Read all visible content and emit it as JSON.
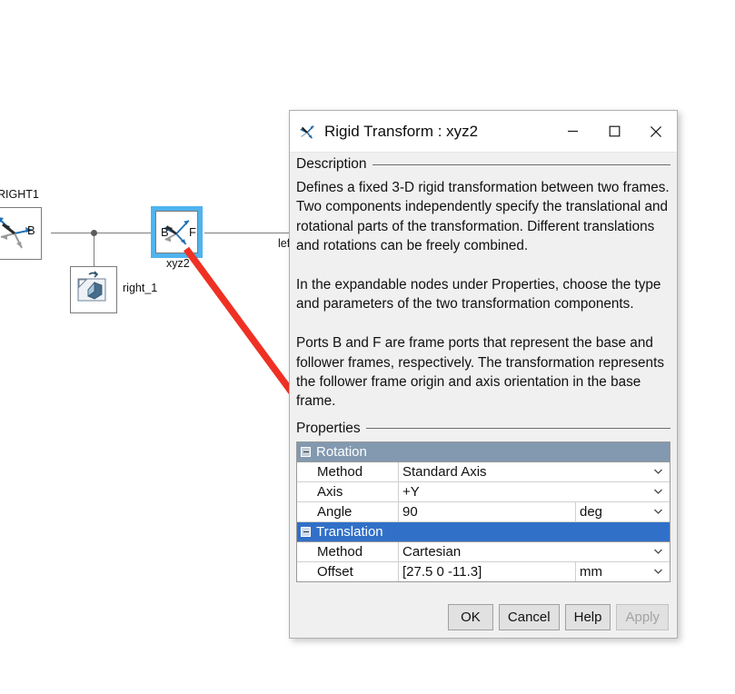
{
  "canvas": {
    "blocks": [
      {
        "name": "RIGHT1",
        "port_b": "B",
        "label_position": "top"
      },
      {
        "name": "right_1",
        "label_position": "right"
      },
      {
        "name": "xyz2",
        "port_b": "B",
        "port_f": "F",
        "label_position": "bottom",
        "selected": true
      }
    ],
    "truncated_label": "lef",
    "annotation_arrow_color": "#ef3124"
  },
  "dialog": {
    "title": "Rigid Transform : xyz2",
    "title_icon": "frame-axes-icon",
    "window_buttons": {
      "minimize": "minimize-icon",
      "maximize": "maximize-icon",
      "close": "close-icon"
    },
    "description_group_label": "Description",
    "description_text": "Defines a fixed 3-D rigid transformation between two frames. Two components independently specify the translational and rotational parts of the transformation. Different translations and rotations can be freely combined.\n\nIn the expandable nodes under Properties, choose the type and parameters of the two transformation components.\n\nPorts B and F are frame ports that represent the base and follower frames, respectively. The transformation represents the follower frame origin and axis orientation in the base frame.",
    "properties_group_label": "Properties",
    "properties": [
      {
        "kind": "section",
        "label": "Rotation",
        "selected": false,
        "expanded": true
      },
      {
        "kind": "field",
        "name": "Method",
        "value": "Standard Axis",
        "unit": null,
        "has_dropdown": true
      },
      {
        "kind": "field",
        "name": "Axis",
        "value": "+Y",
        "unit": null,
        "has_dropdown": true
      },
      {
        "kind": "field",
        "name": "Angle",
        "value": "90",
        "unit": "deg",
        "has_dropdown": true
      },
      {
        "kind": "section",
        "label": "Translation",
        "selected": true,
        "expanded": true
      },
      {
        "kind": "field",
        "name": "Method",
        "value": "Cartesian",
        "unit": null,
        "has_dropdown": true
      },
      {
        "kind": "field",
        "name": "Offset",
        "value": "[27.5 0 -11.3]",
        "unit": "mm",
        "has_dropdown": true
      }
    ],
    "buttons": [
      {
        "label": "OK",
        "disabled": false
      },
      {
        "label": "Cancel",
        "disabled": false
      },
      {
        "label": "Help",
        "disabled": false
      },
      {
        "label": "Apply",
        "disabled": true
      }
    ]
  },
  "colors": {
    "section_inactive": "#8299b0",
    "section_active": "#3170c8",
    "selection_outline": "#4fb3ee",
    "arrow": "#ef3124"
  }
}
